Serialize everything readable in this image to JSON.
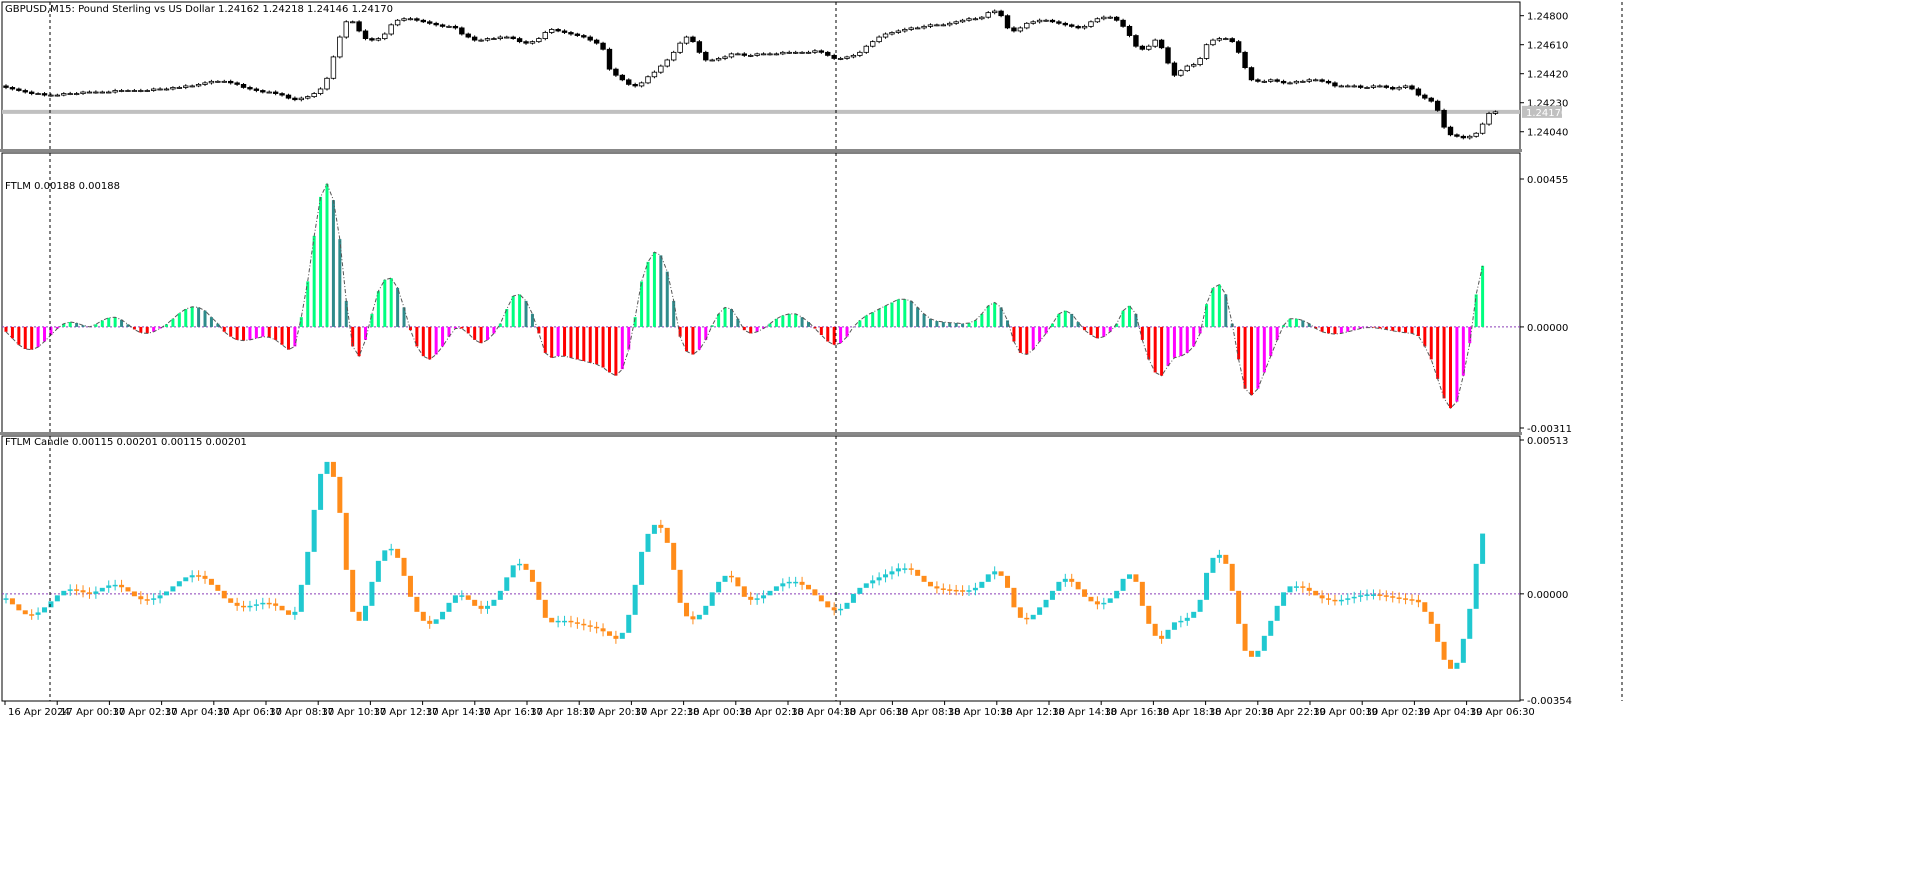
{
  "main": {
    "symbol_label": "GBPUSD,M15:  Pound Sterling vs US Dollar  1.24162 1.24218 1.24146 1.24170",
    "price_ticks": [
      "1.24800",
      "1.24610",
      "1.24420",
      "1.24230",
      "1.24040"
    ],
    "price_tick_values": [
      1.248,
      1.2461,
      1.2442,
      1.2423,
      1.2404
    ],
    "current_price_label": "1.24170",
    "current_price": 1.2417
  },
  "ftlm": {
    "label": "FTLM 0.00188 0.00188",
    "ticks": [
      "0.00455",
      "0.00000",
      "-0.00311"
    ],
    "tick_values": [
      0.00455,
      0,
      -0.00311
    ]
  },
  "ftlm_candle": {
    "label": "FTLM Candle 0.00115 0.00201 0.00115 0.00201",
    "ticks": [
      "0.00513",
      "0.00000",
      "-0.00354"
    ],
    "tick_values": [
      0.00513,
      0,
      -0.00354
    ]
  },
  "time_axis": {
    "labels": [
      "16 Apr 2024",
      "17 Apr 00:30",
      "17 Apr 02:30",
      "17 Apr 04:30",
      "17 Apr 06:30",
      "17 Apr 08:30",
      "17 Apr 10:30",
      "17 Apr 12:30",
      "17 Apr 14:30",
      "17 Apr 16:30",
      "17 Apr 18:30",
      "17 Apr 20:30",
      "17 Apr 22:30",
      "18 Apr 00:30",
      "18 Apr 02:30",
      "18 Apr 04:30",
      "18 Apr 06:30",
      "18 Apr 08:30",
      "18 Apr 10:30",
      "18 Apr 12:30",
      "18 Apr 14:30",
      "18 Apr 16:30",
      "18 Apr 18:30",
      "18 Apr 20:30",
      "18 Apr 22:30",
      "19 Apr 00:30",
      "19 Apr 02:30",
      "19 Apr 04:30",
      "19 Apr 06:30"
    ],
    "period_separators": [
      "17 Apr 2024",
      "18 Apr 2024",
      "19 Apr 2024"
    ]
  },
  "colors": {
    "bull_candle": "#ffffff",
    "bear_candle": "#000000",
    "ftlm_up_strong": "#00ff7f",
    "ftlm_up_weak": "#2e8b8b",
    "ftlm_down_strong": "#ff0000",
    "ftlm_down_weak": "#ff00ff",
    "candle_up": "#20c8d0",
    "candle_down": "#ff8c1a",
    "zero_line": "#8b3fb8",
    "current_price_line": "#c0c0c0"
  },
  "chart_data": [
    {
      "type": "candlestick",
      "title": "GBPUSD,M15:  Pound Sterling vs US Dollar",
      "ylim": [
        1.2394,
        1.2487
      ],
      "close": [
        1.2433,
        1.2432,
        1.2431,
        1.243,
        1.2429,
        1.2429,
        1.2428,
        1.2428,
        1.2428,
        1.2429,
        1.2429,
        1.2429,
        1.243,
        1.243,
        1.243,
        1.243,
        1.243,
        1.2431,
        1.2431,
        1.2431,
        1.2431,
        1.2431,
        1.2431,
        1.2432,
        1.2432,
        1.2432,
        1.2433,
        1.2433,
        1.2434,
        1.2434,
        1.2435,
        1.2436,
        1.2437,
        1.2437,
        1.2437,
        1.2436,
        1.2435,
        1.2433,
        1.2432,
        1.2431,
        1.243,
        1.243,
        1.2429,
        1.2428,
        1.2426,
        1.2425,
        1.2426,
        1.2427,
        1.2429,
        1.2432,
        1.2439,
        1.2453,
        1.2466,
        1.2476,
        1.2476,
        1.247,
        1.2465,
        1.2464,
        1.2465,
        1.2468,
        1.2474,
        1.2477,
        1.2478,
        1.2478,
        1.2477,
        1.2476,
        1.2475,
        1.2474,
        1.2473,
        1.2473,
        1.2472,
        1.2468,
        1.2466,
        1.2464,
        1.2464,
        1.2465,
        1.2465,
        1.2466,
        1.2466,
        1.2465,
        1.2463,
        1.2462,
        1.2463,
        1.2465,
        1.2469,
        1.2471,
        1.247,
        1.2469,
        1.2468,
        1.2467,
        1.2466,
        1.2464,
        1.2462,
        1.2458,
        1.2445,
        1.2441,
        1.2438,
        1.2435,
        1.2434,
        1.2436,
        1.244,
        1.2443,
        1.2447,
        1.2451,
        1.2456,
        1.2462,
        1.2466,
        1.2463,
        1.2456,
        1.2451,
        1.2451,
        1.2452,
        1.2453,
        1.2455,
        1.2455,
        1.2454,
        1.2454,
        1.2455,
        1.2455,
        1.2455,
        1.2455,
        1.2456,
        1.2456,
        1.2456,
        1.2456,
        1.2456,
        1.2457,
        1.2456,
        1.2454,
        1.2452,
        1.2452,
        1.2453,
        1.2454,
        1.2456,
        1.246,
        1.2463,
        1.2466,
        1.2468,
        1.2469,
        1.247,
        1.2471,
        1.2472,
        1.2472,
        1.2473,
        1.2474,
        1.2474,
        1.2474,
        1.2475,
        1.2476,
        1.2477,
        1.2478,
        1.2478,
        1.2479,
        1.2482,
        1.2483,
        1.248,
        1.2472,
        1.247,
        1.2472,
        1.2475,
        1.2476,
        1.2477,
        1.2477,
        1.2476,
        1.2475,
        1.2474,
        1.2473,
        1.2472,
        1.2473,
        1.2476,
        1.2478,
        1.2479,
        1.2479,
        1.2477,
        1.2473,
        1.2467,
        1.246,
        1.2458,
        1.246,
        1.2464,
        1.2459,
        1.2449,
        1.2441,
        1.2444,
        1.2447,
        1.2448,
        1.2452,
        1.2461,
        1.2464,
        1.2465,
        1.2465,
        1.2463,
        1.2456,
        1.2446,
        1.2438,
        1.2437,
        1.2437,
        1.2438,
        1.2437,
        1.2436,
        1.2436,
        1.2437,
        1.2437,
        1.2438,
        1.2438,
        1.2437,
        1.2436,
        1.2434,
        1.2434,
        1.2434,
        1.2434,
        1.2433,
        1.2433,
        1.2434,
        1.2434,
        1.2433,
        1.2432,
        1.2433,
        1.2434,
        1.2432,
        1.2428,
        1.2426,
        1.2424,
        1.2418,
        1.2407,
        1.2402,
        1.2401,
        1.24,
        1.2401,
        1.2403,
        1.2409,
        1.2416,
        1.2417
      ]
    },
    {
      "type": "bar",
      "title": "FTLM",
      "ylim": [
        -0.00311,
        0.00455
      ],
      "values": [
        -0.00015,
        -0.00035,
        -0.00055,
        -0.00068,
        -0.0007,
        -0.00062,
        -0.00045,
        -0.00025,
        -5e-05,
        0.0001,
        0.00015,
        0.00012,
        5e-05,
        0.0,
        8e-05,
        0.0002,
        0.00028,
        0.0003,
        0.00022,
        8e-05,
        -8e-05,
        -0.00018,
        -0.0002,
        -0.00015,
        -5e-05,
        8e-05,
        0.00025,
        0.00042,
        0.00055,
        0.00062,
        0.0006,
        0.0005,
        0.0003,
        0.0001,
        -0.00015,
        -0.0003,
        -0.0004,
        -0.00042,
        -0.0004,
        -0.00035,
        -0.0003,
        -0.00032,
        -0.0004,
        -0.00055,
        -0.0007,
        -0.0006,
        0.0003,
        0.0014,
        0.0028,
        0.004,
        0.0044,
        0.0039,
        0.0027,
        0.0008,
        -0.0006,
        -0.0009,
        -0.0004,
        0.0004,
        0.0011,
        0.00145,
        0.0015,
        0.0012,
        0.0006,
        -0.0001,
        -0.0006,
        -0.0009,
        -0.001,
        -0.00085,
        -0.0006,
        -0.0003,
        -5e-05,
        -5e-05,
        -0.0002,
        -0.0004,
        -0.0005,
        -0.0004,
        -0.0002,
        0.0001,
        0.00055,
        0.00095,
        0.001,
        0.0008,
        0.0004,
        -0.0002,
        -0.0008,
        -0.00095,
        -0.0009,
        -0.0009,
        -0.00095,
        -0.001,
        -0.00105,
        -0.0011,
        -0.00115,
        -0.00125,
        -0.0014,
        -0.0015,
        -0.0013,
        -0.0007,
        0.0003,
        0.0014,
        0.002,
        0.0023,
        0.0022,
        0.0017,
        0.0008,
        -0.0003,
        -0.00075,
        -0.00085,
        -0.0007,
        -0.0004,
        5e-05,
        0.0004,
        0.0006,
        0.00055,
        0.00025,
        -0.0001,
        -0.0002,
        -0.00015,
        -5e-05,
        0.0001,
        0.00025,
        0.00035,
        0.0004,
        0.0004,
        0.0003,
        0.00015,
        -5e-05,
        -0.00025,
        -0.00045,
        -0.00055,
        -0.0005,
        -0.0003,
        0.0,
        0.0002,
        0.00035,
        0.00045,
        0.00055,
        0.00065,
        0.00075,
        0.00085,
        0.00085,
        0.0008,
        0.0006,
        0.0004,
        0.00025,
        0.00018,
        0.00015,
        0.00013,
        0.00012,
        0.0001,
        0.00012,
        0.0002,
        0.0004,
        0.00065,
        0.00075,
        0.0006,
        0.0002,
        -0.00045,
        -0.0008,
        -0.00085,
        -0.0007,
        -0.00045,
        -0.0002,
        0.0001,
        0.0004,
        0.0005,
        0.0004,
        0.00015,
        -0.0001,
        -0.00025,
        -0.00035,
        -0.0003,
        -0.00015,
        0.0001,
        0.0005,
        0.00065,
        0.0004,
        -0.0004,
        -0.001,
        -0.0014,
        -0.0015,
        -0.0012,
        -0.00095,
        -0.0009,
        -0.0008,
        -0.0006,
        -0.0002,
        0.0007,
        0.0012,
        0.0013,
        0.001,
        0.0001,
        -0.001,
        -0.0019,
        -0.0021,
        -0.0019,
        -0.0014,
        -0.0009,
        -0.0004,
        5e-05,
        0.00025,
        0.00025,
        0.0002,
        0.0001,
        -5e-05,
        -0.00015,
        -0.0002,
        -0.00022,
        -0.0002,
        -0.00015,
        -0.0001,
        -5e-05,
        -2e-05,
        -2e-05,
        -5e-05,
        -8e-05,
        -0.00012,
        -0.00015,
        -0.00018,
        -0.0002,
        -0.00028,
        -0.0006,
        -0.001,
        -0.0016,
        -0.0022,
        -0.0025,
        -0.0023,
        -0.0015,
        -0.0005,
        0.001,
        0.00188
      ]
    },
    {
      "type": "candlestick",
      "title": "FTLM Candle",
      "ylim": [
        -0.00354,
        0.00513
      ],
      "close": [
        -0.00015,
        -0.00035,
        -0.00055,
        -0.00068,
        -0.0007,
        -0.00062,
        -0.00045,
        -0.00025,
        -5e-05,
        0.0001,
        0.00015,
        0.00012,
        5e-05,
        0.0,
        8e-05,
        0.0002,
        0.00028,
        0.0003,
        0.00022,
        8e-05,
        -8e-05,
        -0.00018,
        -0.0002,
        -0.00015,
        -5e-05,
        8e-05,
        0.00025,
        0.00042,
        0.00055,
        0.00062,
        0.0006,
        0.0005,
        0.0003,
        0.0001,
        -0.00015,
        -0.0003,
        -0.0004,
        -0.00042,
        -0.0004,
        -0.00035,
        -0.0003,
        -0.00032,
        -0.0004,
        -0.00055,
        -0.0007,
        -0.0006,
        0.0003,
        0.0014,
        0.0028,
        0.004,
        0.0044,
        0.0039,
        0.0027,
        0.0008,
        -0.0006,
        -0.0009,
        -0.0004,
        0.0004,
        0.0011,
        0.00145,
        0.0015,
        0.0012,
        0.0006,
        -0.0001,
        -0.0006,
        -0.0009,
        -0.001,
        -0.00085,
        -0.0006,
        -0.0003,
        -5e-05,
        -5e-05,
        -0.0002,
        -0.0004,
        -0.0005,
        -0.0004,
        -0.0002,
        0.0001,
        0.00055,
        0.00095,
        0.001,
        0.0008,
        0.0004,
        -0.0002,
        -0.0008,
        -0.00095,
        -0.0009,
        -0.0009,
        -0.00095,
        -0.001,
        -0.00105,
        -0.0011,
        -0.00115,
        -0.00125,
        -0.0014,
        -0.0015,
        -0.0013,
        -0.0007,
        0.0003,
        0.0014,
        0.002,
        0.0023,
        0.0022,
        0.0017,
        0.0008,
        -0.0003,
        -0.00075,
        -0.00085,
        -0.0007,
        -0.0004,
        5e-05,
        0.0004,
        0.0006,
        0.00055,
        0.00025,
        -0.0001,
        -0.0002,
        -0.00015,
        -5e-05,
        0.0001,
        0.00025,
        0.00035,
        0.0004,
        0.0004,
        0.0003,
        0.00015,
        -5e-05,
        -0.00025,
        -0.00045,
        -0.00055,
        -0.0005,
        -0.0003,
        0.0,
        0.0002,
        0.00035,
        0.00045,
        0.00055,
        0.00065,
        0.00075,
        0.00085,
        0.00085,
        0.0008,
        0.0006,
        0.0004,
        0.00025,
        0.00018,
        0.00015,
        0.00013,
        0.00012,
        0.0001,
        0.00012,
        0.0002,
        0.0004,
        0.00065,
        0.00075,
        0.0006,
        0.0002,
        -0.00045,
        -0.0008,
        -0.00085,
        -0.0007,
        -0.00045,
        -0.0002,
        0.0001,
        0.0004,
        0.0005,
        0.0004,
        0.00015,
        -0.0001,
        -0.00025,
        -0.00035,
        -0.0003,
        -0.00015,
        0.0001,
        0.0005,
        0.00065,
        0.0004,
        -0.0004,
        -0.001,
        -0.0014,
        -0.0015,
        -0.0012,
        -0.00095,
        -0.0009,
        -0.0008,
        -0.0006,
        -0.0002,
        0.0007,
        0.0012,
        0.0013,
        0.001,
        0.0001,
        -0.001,
        -0.0019,
        -0.0021,
        -0.0019,
        -0.0014,
        -0.0009,
        -0.0004,
        5e-05,
        0.00025,
        0.00025,
        0.0002,
        0.0001,
        -5e-05,
        -0.00015,
        -0.0002,
        -0.00022,
        -0.0002,
        -0.00015,
        -0.0001,
        -5e-05,
        -2e-05,
        -2e-05,
        -5e-05,
        -8e-05,
        -0.00012,
        -0.00015,
        -0.00018,
        -0.0002,
        -0.00028,
        -0.0006,
        -0.001,
        -0.0016,
        -0.0022,
        -0.0025,
        -0.0023,
        -0.0015,
        -0.0005,
        0.001,
        0.00201
      ]
    }
  ]
}
